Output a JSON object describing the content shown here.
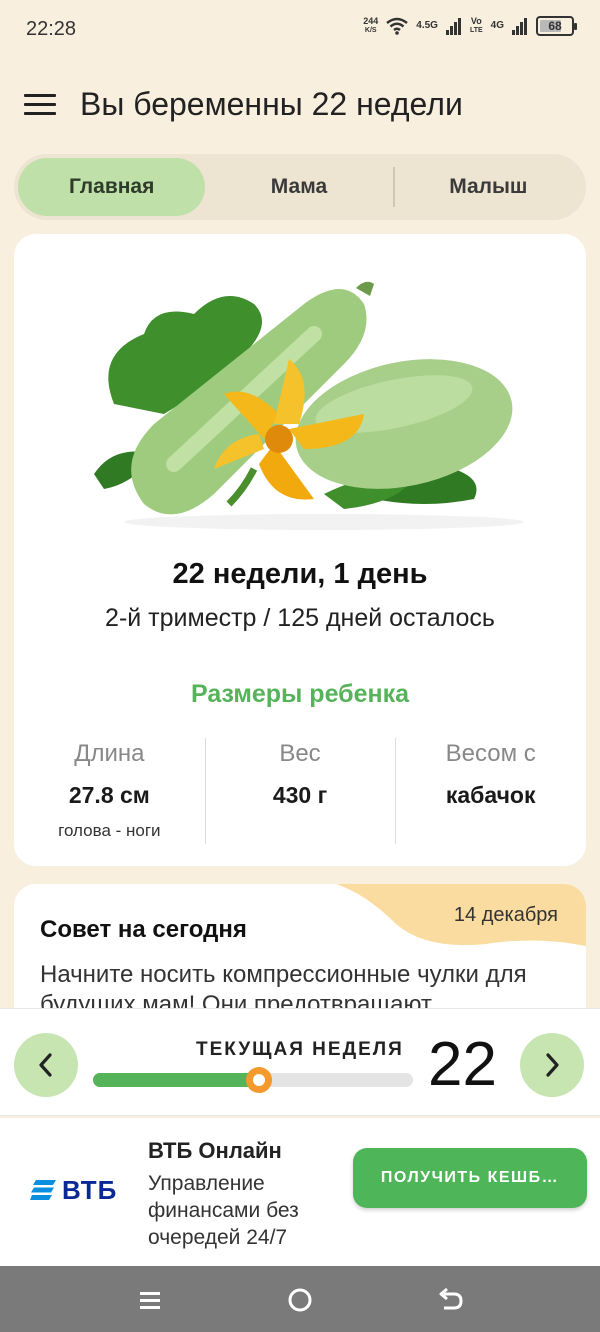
{
  "status_bar": {
    "time": "22:28",
    "net_speed_value": "244",
    "net_speed_unit": "K/S",
    "sig1_label": "4.5G",
    "volte_top": "Vo",
    "volte_bottom": "LTE",
    "sig2_label": "4G",
    "battery": "68"
  },
  "app_bar": {
    "title": "Вы беременны 22 недели"
  },
  "tabs": [
    {
      "label": "Главная",
      "active": true
    },
    {
      "label": "Мама",
      "active": false
    },
    {
      "label": "Малыш",
      "active": false
    }
  ],
  "summary": {
    "week_day": "22 недели, 1 день",
    "trimester_remaining": "2-й триместр / 125 дней осталось",
    "sizes_title": "Размеры ребенка",
    "metrics": [
      {
        "label": "Длина",
        "value": "27.8 см",
        "note": "голова - ноги"
      },
      {
        "label": "Вес",
        "value": "430 г",
        "note": ""
      },
      {
        "label": "Весом с",
        "value": "кабачок",
        "note": ""
      }
    ]
  },
  "tip": {
    "title": "Совет на сегодня",
    "date": "14 декабря",
    "text": "Начните носить компрессионные чулки для будущих мам! Они предотвращают"
  },
  "week_nav": {
    "label": "ТЕКУЩАЯ НЕДЕЛЯ",
    "week": "22",
    "progress_fraction": 0.52
  },
  "ad": {
    "brand": "ВТБ",
    "title": "ВТБ Онлайн",
    "text": "Управление финансами без очередей 24/7",
    "button": "ПОЛУЧИТЬ КЕШБ…"
  },
  "colors": {
    "accent_green": "#55b35a",
    "tab_active": "#bfe0a8",
    "knob_orange": "#f39a2e",
    "background": "#f8efdf"
  }
}
